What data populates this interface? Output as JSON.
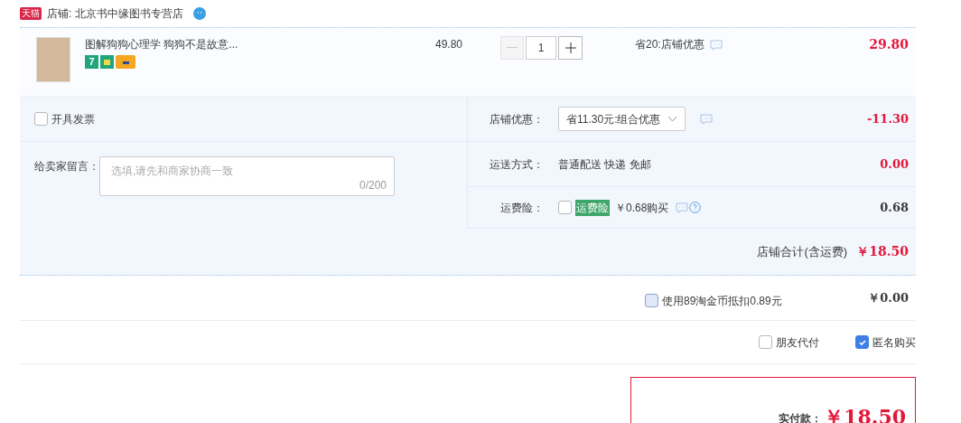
{
  "shop": {
    "badge": "天猫",
    "name": "店铺: 北京书中缘图书专营店"
  },
  "item": {
    "title": "图解狗狗心理学 狗狗不是故意...",
    "return_days": "7",
    "price": "49.80",
    "quantity": "1",
    "minus_disabled": true,
    "discount": "省20:店铺优惠",
    "subtotal": "29.80"
  },
  "invoice": {
    "label": "开具发票",
    "checked": false
  },
  "message": {
    "label": "给卖家留言：",
    "placeholder": "选填,请先和商家协商一致",
    "counter": "0/200"
  },
  "options": [
    {
      "kind": "select",
      "label": "店铺优惠：",
      "value": "省11.30元:组合优惠",
      "amount": "-11.30",
      "highlight": true
    },
    {
      "kind": "text",
      "label": "运送方式：",
      "value": "普通配送 快递 免邮",
      "amount": "0.00",
      "highlight": true
    },
    {
      "kind": "insurance",
      "label": "运费险：",
      "checked": false,
      "tag": "运费险",
      "value": "￥0.68购买",
      "amount": "0.68",
      "highlight": false
    }
  ],
  "shop_total": {
    "label": "店铺合计(含运费)",
    "amount": "￥18.50"
  },
  "coins": {
    "label": "使用89淘金币抵扣0.89元",
    "checked": false,
    "amount": "￥0.00"
  },
  "extras": [
    {
      "label": "朋友代付",
      "checked": false
    },
    {
      "label": "匿名购买",
      "checked": true
    }
  ],
  "payment": {
    "label": "实付款：",
    "amount": "￥18.50"
  }
}
